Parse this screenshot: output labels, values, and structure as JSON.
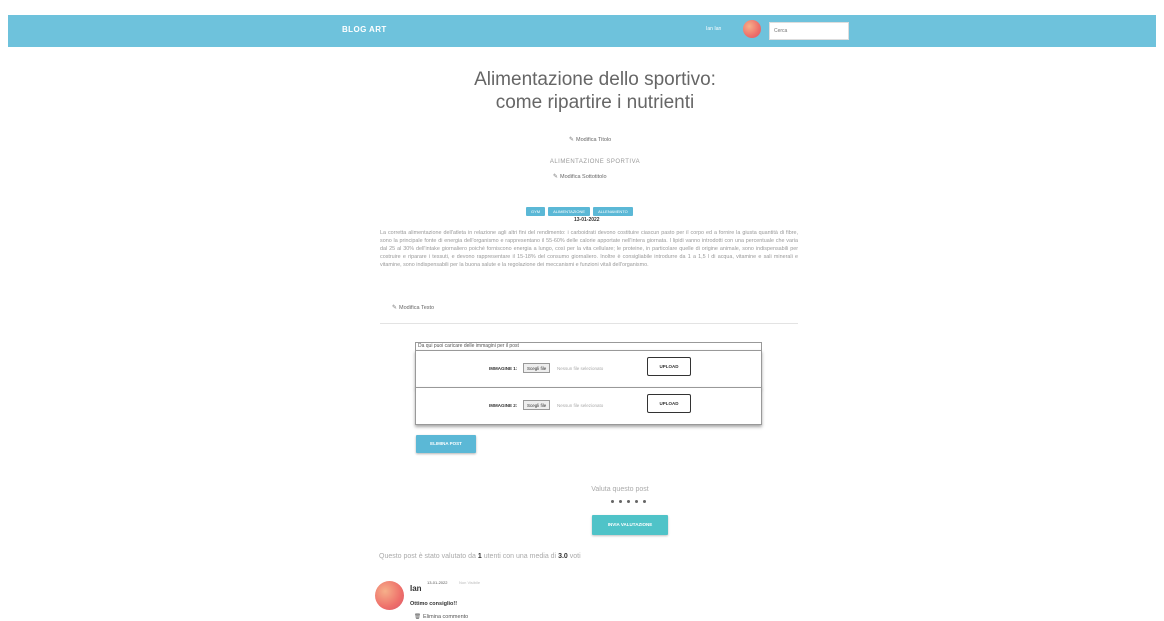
{
  "header": {
    "brand": "BLOG ART",
    "user_label": "Ian Ian",
    "search_placeholder": "Cerca"
  },
  "post": {
    "title": "Alimentazione dello sportivo: come ripartire i nutrienti",
    "edit_title": "Modifica Titolo",
    "subtitle": "ALIMENTAZIONE SPORTIVA",
    "edit_subtitle": "Modifica Sottotitolo",
    "tags": [
      "GYM",
      "ALIMENTAZIONE",
      "ALLENAMENTO"
    ],
    "date": "13-01-2022",
    "body": "La corretta alimentazione dell'atleta in relazione agli altri fini del rendimento: i carboidrati devono costituire ciascun pasto per il corpo ed a fornire la giusta quantità di fibre, sono la principale fonte di energia dell'organismo e rappresentano il 55-60% delle calorie apportate nell'intera giornata. I lipidi vanno introdotti con una percentuale che varia dal 25 al 30% dell'intake giornaliero poiché forniscono energia a lungo, così per la vita cellulare; le proteine, in particolare quelle di origine animale, sono indispensabili per costruire e riparare i tessuti, e devono rappresentare il 15-18% del consumo giornaliero. Inoltre è consigliabile introdurre da 1 a 1,5 l di acqua, vitamine e sali minerali e vitamine, sono indispensabili per la buona salute e la regolazione dei meccanismi e funzioni vitali dell'organismo.",
    "edit_text": "Modifica Testo"
  },
  "upload": {
    "hint": "Da qui puoi caricare delle immagini per il post",
    "rows": [
      {
        "label": "IMMAGINE 1:",
        "file_button": "Scegli file",
        "no_file": "Nessun file selezionato",
        "upload": "UPLOAD"
      },
      {
        "label": "IMMAGINE 2:",
        "file_button": "Scegli file",
        "no_file": "Nessun file selezionato",
        "upload": "UPLOAD"
      }
    ]
  },
  "delete_post": "ELIMINA POST",
  "rating": {
    "label": "Valuta questo post",
    "stars": 5,
    "send": "INVIA VALUTAZIONE",
    "summary_prefix": "Questo post è stato valutato da",
    "users_count": "1",
    "summary_mid": "utenti con una media di",
    "average": "3.0",
    "summary_suffix": "voti"
  },
  "comment": {
    "author": "Ian",
    "date": "13-01-2022",
    "status": "Non Visibile",
    "text": "Ottimo consiglio!!",
    "delete": "Elimina commento"
  },
  "colors": {
    "header": "#6ec2dc",
    "tag": "#5bb8d6",
    "rating_button": "#4fc3c8"
  }
}
